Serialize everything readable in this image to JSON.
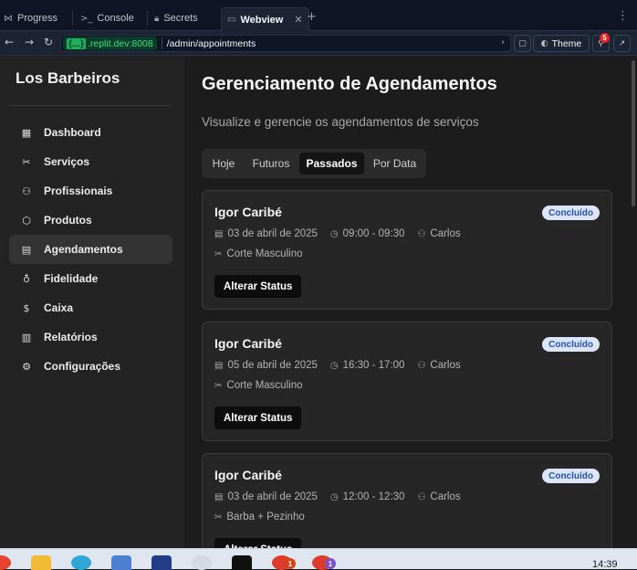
{
  "browser": {
    "tabs": [
      {
        "icon": "progress-icon",
        "glyph": "⋈",
        "label": "Progress"
      },
      {
        "icon": "console-icon",
        "glyph": ">_",
        "label": "Console"
      },
      {
        "icon": "lock-icon",
        "glyph": "🔒",
        "label": "Secrets"
      },
      {
        "icon": "webview-icon",
        "glyph": "▭",
        "label": "Webview",
        "active": true
      }
    ],
    "add_tab": "+",
    "menu": "⋮",
    "url_host_brace": "{...}",
    "url_host": ".replit.dev:8008",
    "url_path": "/admin/appointments",
    "theme_label": "Theme",
    "notifications_count": "5"
  },
  "sidebar": {
    "brand": "Los Barbeiros",
    "items": [
      {
        "label": "Dashboard",
        "icon": "dashboard-icon",
        "glyph": "▦"
      },
      {
        "label": "Serviços",
        "icon": "scissors-icon",
        "glyph": "✂"
      },
      {
        "label": "Profissionais",
        "icon": "users-icon",
        "glyph": "⚇"
      },
      {
        "label": "Produtos",
        "icon": "package-icon",
        "glyph": "⬡"
      },
      {
        "label": "Agendamentos",
        "icon": "calendar-icon",
        "glyph": "▤",
        "active": true
      },
      {
        "label": "Fidelidade",
        "icon": "award-icon",
        "glyph": "♁"
      },
      {
        "label": "Caixa",
        "icon": "dollar-icon",
        "glyph": "$"
      },
      {
        "label": "Relatórios",
        "icon": "bar-chart-icon",
        "glyph": "▥"
      },
      {
        "label": "Configurações",
        "icon": "gear-icon",
        "glyph": "⚙"
      }
    ]
  },
  "main": {
    "title": "Gerenciamento de Agendamentos",
    "subtitle": "Visualize e gerencie os agendamentos de serviços",
    "tabs": [
      "Hoje",
      "Futuros",
      "Passados",
      "Por Data"
    ],
    "active_tab": "Passados",
    "appointments": [
      {
        "client": "Igor Caribé",
        "status": "Concluído",
        "date": "03 de abril de 2025",
        "time": "09:00 - 09:30",
        "professional": "Carlos",
        "service": "Corte Masculino",
        "action": "Alterar Status"
      },
      {
        "client": "Igor Caribé",
        "status": "Concluído",
        "date": "05 de abril de 2025",
        "time": "16:30 - 17:00",
        "professional": "Carlos",
        "service": "Corte Masculino",
        "action": "Alterar Status"
      },
      {
        "client": "Igor Caribé",
        "status": "Concluído",
        "date": "03 de abril de 2025",
        "time": "12:00 - 12:30",
        "professional": "Carlos",
        "service": "Barba + Pezinho",
        "action": "Alterar Status"
      }
    ]
  },
  "taskbar": {
    "clock": "14:39",
    "badges": [
      "1",
      "1"
    ]
  },
  "colors": {
    "sidebar_bg": "#232323",
    "main_bg": "#1c1c1c",
    "card_bg": "#262626",
    "badge_bg": "#dbe6fb",
    "badge_text": "#2b4fa8",
    "url_host_text": "#3ee07b"
  }
}
